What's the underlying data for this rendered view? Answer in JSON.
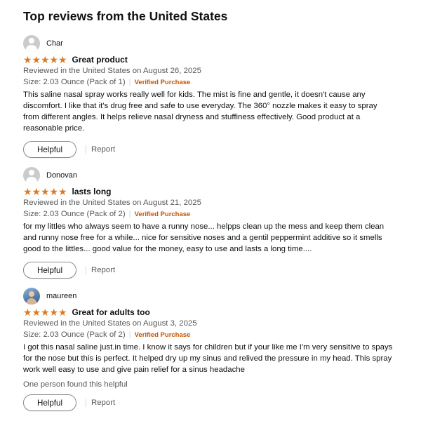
{
  "heading": "Top reviews from the United States",
  "colors": {
    "star": "#de7921",
    "verified": "#c45500",
    "text": "#0f1111",
    "muted": "#565959"
  },
  "reviews": [
    {
      "author": "Char",
      "avatar": "default-avatar-icon",
      "rating": 5,
      "stars": "★★★★★",
      "title": "Great product",
      "date": "Reviewed in the United States on August 26, 2025",
      "size": "Size: 2.03 Ounce (Pack of 1)",
      "separator": "|",
      "verified": "Verified Purchase",
      "body": "This saline nasal spray works really well for kids. The mist is fine and gentle, it doesn't cause any discomfort. I like that it's drug free and safe to use everyday. The 360° nozzle makes it easy to spray from different angles. It helps relieve nasal dryness and stuffiness effectively. Good product at a reasonable price.",
      "helpful_count": "",
      "helpful_label": "Helpful",
      "report_label": "Report"
    },
    {
      "author": "Donovan",
      "avatar": "default-avatar-icon",
      "rating": 5,
      "stars": "★★★★★",
      "title": "lasts long",
      "date": "Reviewed in the United States on August 21, 2025",
      "size": "Size: 2.03 Ounce (Pack of 2)",
      "separator": "|",
      "verified": "Verified Purchase",
      "body": "for my littles who always seem to have a runny nose... helpps clean up the mess and keep them clean and runny nose free for a while... nice for sensitive noses and a gentil peppermint additive so it smells good to the littles... good value for the money, easy to use and lasts a long time....",
      "helpful_count": "",
      "helpful_label": "Helpful",
      "report_label": "Report"
    },
    {
      "author": "maureen",
      "avatar": "profile-photo",
      "rating": 5,
      "stars": "★★★★★",
      "title": "Great for adults too",
      "date": "Reviewed in the United States on August 3, 2025",
      "size": "Size: 2.03 Ounce (Pack of 2)",
      "separator": "|",
      "verified": "Verified Purchase",
      "body": "I got this nasal saline just.in time. I know it says for children but if your like me I'm very sensitive to spays for the nose but this is perfect. It helped dry up my sinus and relived the pressure in my head. This spray work well easy to use and give pain relief for a sinus headache",
      "helpful_count": "One person found this helpful",
      "helpful_label": "Helpful",
      "report_label": "Report"
    }
  ]
}
